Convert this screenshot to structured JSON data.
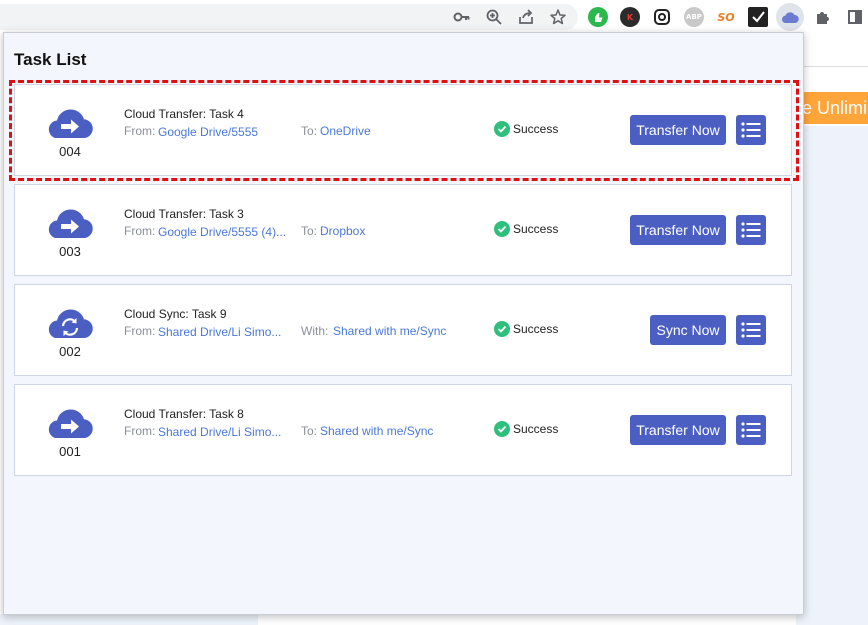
{
  "browser": {
    "toolbar_icons": [
      "key-icon",
      "zoom-icon",
      "share-icon",
      "star-icon"
    ],
    "extensions": [
      {
        "name": "green-thumb-extension",
        "label": "",
        "color": "#2db84d"
      },
      {
        "name": "k-extension",
        "label": "K",
        "color": "#2b2b2b"
      },
      {
        "name": "link-extension",
        "label": "",
        "color": "#222222"
      },
      {
        "name": "adblock-extension",
        "label": "ABP",
        "color": "#c9c9c9"
      },
      {
        "name": "so-extension",
        "label": "SO",
        "color": "#f07d1e"
      },
      {
        "name": "checkbox-extension",
        "label": "",
        "color": "#222222"
      },
      {
        "name": "multcloud-extension",
        "label": "",
        "color": "#6a7bd1"
      },
      {
        "name": "puzzle-extension",
        "label": "",
        "color": "#5f6368"
      },
      {
        "name": "sidebar-extension",
        "label": "",
        "color": "#5f6368"
      }
    ]
  },
  "background_page": {
    "banner_text": "e Unlimi"
  },
  "popup": {
    "title": "Task List"
  },
  "tasks": [
    {
      "number": "004",
      "name": "Cloud Transfer: Task 4",
      "from_label": "From:",
      "from_value": "Google Drive/5555",
      "to_label": "To:",
      "to_value": "OneDrive",
      "status": "Success",
      "action_label": "Transfer Now",
      "icon": "cloud-transfer-icon"
    },
    {
      "number": "003",
      "name": "Cloud Transfer: Task 3",
      "from_label": "From:",
      "from_value": "Google Drive/5555 (4)...",
      "to_label": "To:",
      "to_value": "Dropbox",
      "status": "Success",
      "action_label": "Transfer Now",
      "icon": "cloud-transfer-icon"
    },
    {
      "number": "002",
      "name": "Cloud Sync: Task 9",
      "from_label": "From:",
      "from_value": "Shared Drive/Li Simo...",
      "to_label": "With:",
      "to_value": "Shared with me/Sync",
      "status": "Success",
      "action_label": "Sync Now",
      "icon": "cloud-sync-icon"
    },
    {
      "number": "001",
      "name": "Cloud Transfer: Task 8",
      "from_label": "From:",
      "from_value": "Shared Drive/Li Simo...",
      "to_label": "To:",
      "to_value": "Shared with me/Sync",
      "status": "Success",
      "action_label": "Transfer Now",
      "icon": "cloud-transfer-icon"
    }
  ],
  "colors": {
    "accent": "#4b5fc3",
    "link": "#4a78d6",
    "success": "#2fbf7d",
    "highlight": "#e01010",
    "banner": "#ffa53a"
  }
}
